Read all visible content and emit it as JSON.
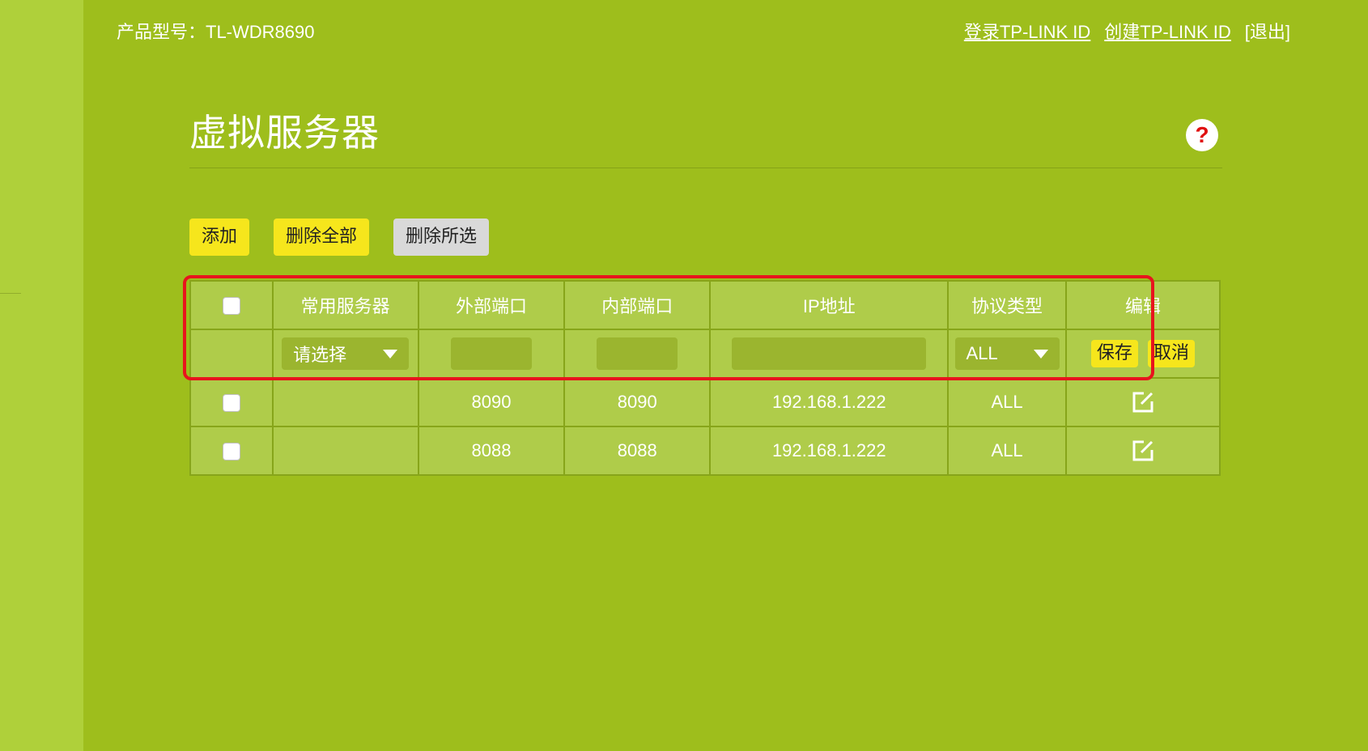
{
  "header": {
    "model_label": "产品型号：TL-WDR8690",
    "login_link": "登录TP-LINK ID",
    "create_link": "创建TP-LINK ID",
    "logout": "[退出]"
  },
  "page": {
    "title": "虚拟服务器",
    "help_icon": "?"
  },
  "toolbar": {
    "add": "添加",
    "delete_all": "删除全部",
    "delete_selected": "删除所选"
  },
  "table": {
    "headers": [
      "常用服务器",
      "外部端口",
      "内部端口",
      "IP地址",
      "协议类型",
      "编辑"
    ],
    "edit_row": {
      "server_select": "请选择",
      "protocol_select": "ALL",
      "save": "保存",
      "cancel": "取消"
    },
    "rows": [
      {
        "server": "",
        "external_port": "8090",
        "internal_port": "8090",
        "ip": "192.168.1.222",
        "protocol": "ALL"
      },
      {
        "server": "",
        "external_port": "8088",
        "internal_port": "8088",
        "ip": "192.168.1.222",
        "protocol": "ALL"
      }
    ]
  },
  "colors": {
    "background": "#9ebe1c",
    "sidebar": "#afd03a",
    "button_yellow": "#f6e61c",
    "button_gray": "#d9d9d9",
    "highlight_red": "#e8141d"
  }
}
